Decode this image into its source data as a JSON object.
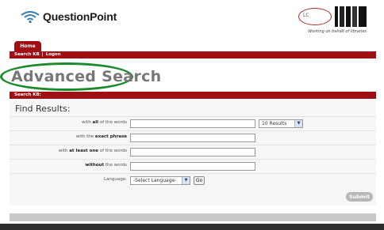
{
  "header": {
    "logo_text": "QuestionPoint",
    "tagline": "Working on behalf of libraries"
  },
  "nav": {
    "home_tab": "Home",
    "links": [
      "Search KB",
      "Logon"
    ]
  },
  "page": {
    "title": "Advanced Search",
    "section_label": "Search KB:",
    "find_label": "Find Results:"
  },
  "form": {
    "rows": [
      {
        "prefix": "with ",
        "bold": "all",
        "suffix": " of the words"
      },
      {
        "prefix": "with the ",
        "bold": "exact phrase",
        "suffix": ""
      },
      {
        "prefix": "with ",
        "bold": "at least one",
        "suffix": " of the words"
      },
      {
        "prefix": "",
        "bold": "without",
        "suffix": " the words"
      }
    ],
    "results_select": "10 Results",
    "language_label": "Language:",
    "language_select": "-Select Language-",
    "go_label": "Go",
    "submit_label": "Submit"
  },
  "colors": {
    "brand_red": "#a00f13",
    "title_grey": "#777777",
    "highlight_green": "#1a8a2a"
  }
}
